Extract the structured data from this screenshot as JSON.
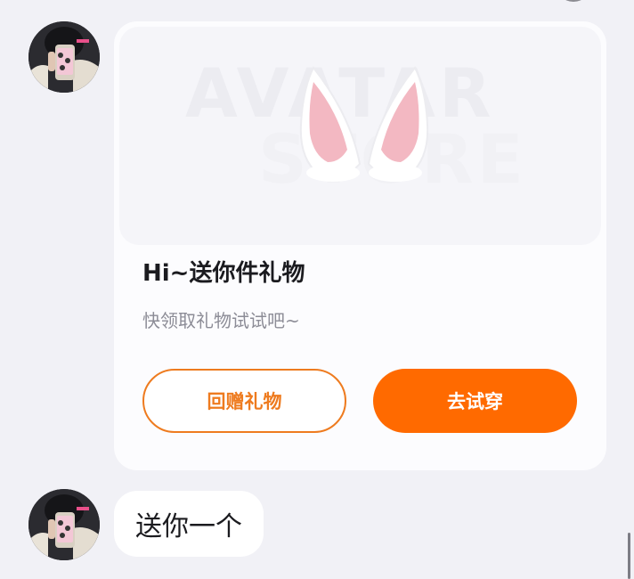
{
  "colors": {
    "accent": "#ff6a00",
    "accent_outline": "#ee7b1f",
    "background": "#f1f1f6",
    "card": "#fcfcfe"
  },
  "messages": [
    {
      "type": "gift-card",
      "avatar": "user-avatar",
      "gift": {
        "image_icon": "bunny-ears-icon",
        "watermark_line1": "AVATAR",
        "watermark_line2": "STORE",
        "title": "Hi~送你件礼物",
        "subtitle": "快领取礼物试试吧~",
        "return_gift_label": "回赠礼物",
        "try_on_label": "去试穿"
      }
    },
    {
      "type": "text",
      "avatar": "user-avatar",
      "text": "送你一个"
    }
  ]
}
